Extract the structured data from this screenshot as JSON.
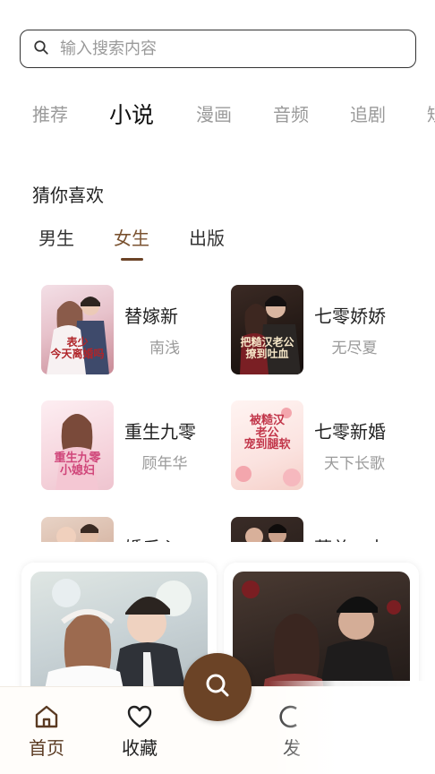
{
  "search": {
    "placeholder": "输入搜索内容"
  },
  "categories": [
    "推荐",
    "小说",
    "漫画",
    "音频",
    "追剧",
    "短"
  ],
  "guess_section": {
    "title": "猜你喜欢"
  },
  "gender_tabs": [
    "男生",
    "女生",
    "出版"
  ],
  "books": [
    {
      "title": "替嫁新",
      "author": "南浅",
      "cover_text": "表少\n今天离婚吗"
    },
    {
      "title": "七零娇娇",
      "author": "无尽夏",
      "cover_text": "把糙汉老公\n撩到吐血"
    },
    {
      "title": "重生九零",
      "author": "顾年华",
      "cover_text": "重生九零\n小媳妇"
    },
    {
      "title": "七零新婚",
      "author": "天下长歌",
      "cover_text": "被糙汉\n老公\n宠到腿软"
    },
    {
      "title": "婚后心",
      "author": ""
    },
    {
      "title": "薄总，太",
      "author": ""
    }
  ],
  "bottom_nav": {
    "home": "首页",
    "favorites": "收藏",
    "third": "发"
  },
  "colors": {
    "accent": "#6b4326",
    "muted": "#9a9a9a"
  }
}
